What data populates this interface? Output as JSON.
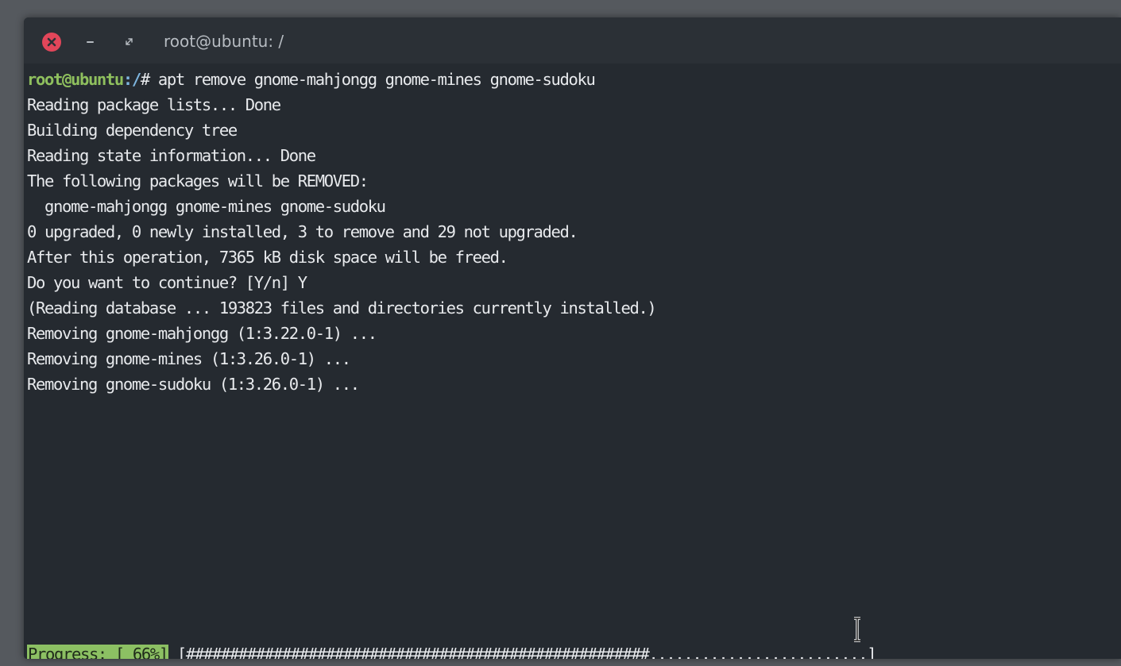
{
  "window": {
    "title": "root@ubuntu: /",
    "controls": {
      "close_icon": "close-icon",
      "minimize_icon": "minimize-icon",
      "maximize_icon": "maximize-icon"
    }
  },
  "terminal": {
    "prompt": {
      "user_host": "root@ubuntu",
      "path": ":/",
      "symbol": "# ",
      "command": "apt remove gnome-mahjongg gnome-mines gnome-sudoku"
    },
    "output": [
      "Reading package lists... Done",
      "Building dependency tree",
      "Reading state information... Done",
      "The following packages will be REMOVED:",
      "  gnome-mahjongg gnome-mines gnome-sudoku",
      "0 upgraded, 0 newly installed, 3 to remove and 29 not upgraded.",
      "After this operation, 7365 kB disk space will be freed.",
      "Do you want to continue? [Y/n] Y",
      "(Reading database ... 193823 files and directories currently installed.)",
      "Removing gnome-mahjongg (1:3.22.0-1) ...",
      "Removing gnome-mines (1:3.26.0-1) ...",
      "Removing gnome-sudoku (1:3.26.0-1) ..."
    ],
    "progress": {
      "label": "Progress: [ 66%]",
      "percent": 66,
      "bar": " [#####################################################.........................]"
    }
  },
  "colors": {
    "window_bg": "#252a30",
    "titlebar_bg": "#2b3036",
    "prompt_user": "#8fc05e",
    "prompt_path": "#7eb6e0",
    "progress_label_bg": "#8cc063",
    "close_button": "#e2465a"
  }
}
